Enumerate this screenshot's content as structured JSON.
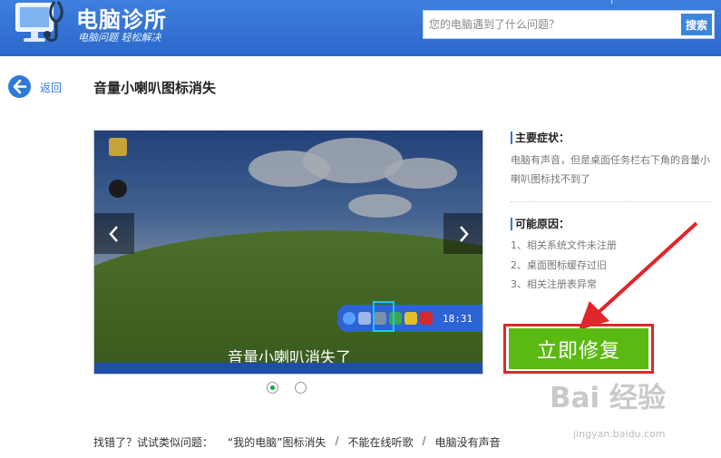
{
  "header": {
    "title": "电脑诊所",
    "slogan": "电脑问题 轻松解决",
    "search_placeholder": "您的电脑遇到了什么问题？",
    "search_button": "搜索",
    "top_links": "   |  "
  },
  "nav": {
    "back_label": "返回"
  },
  "page": {
    "title": "音量小喇叭图标消失"
  },
  "slide": {
    "caption": "音量小喇叭消失了",
    "time": "18:31",
    "pager": [
      true,
      false
    ]
  },
  "symptoms": {
    "title": "主要症状：",
    "text": "电脑有声音，但是桌面任务栏右下角的音量小喇叭图标找不到了"
  },
  "causes": {
    "title": "可能原因：",
    "items": [
      "1、相关系统文件未注册",
      "2、桌面图标缓存过旧",
      "3、相关注册表异常"
    ]
  },
  "fix_button": "立即修复",
  "similar": {
    "prefix": "找错了？试试类似问题：",
    "links": [
      "“我的电脑”图标消失",
      "不能在线听歌",
      "电脑没有声音"
    ],
    "separator": "/"
  },
  "watermark": {
    "brand": "Bai  经验",
    "url": "jingyan.baidu.com"
  },
  "colors": {
    "header": "#2a68cc",
    "accent": "#2f7ad9",
    "fix": "#5bba12",
    "highlight": "#e0262b"
  }
}
